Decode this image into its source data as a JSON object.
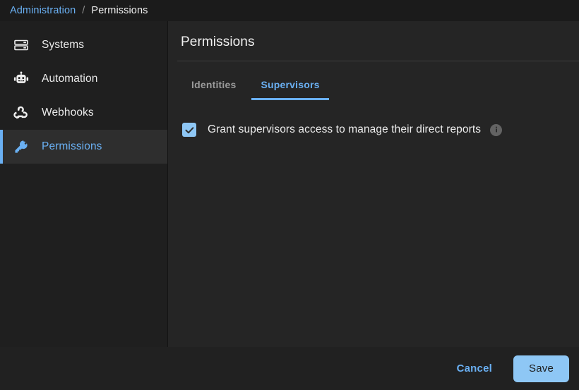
{
  "breadcrumb": {
    "root_label": "Administration",
    "separator": "/",
    "current_label": "Permissions"
  },
  "sidebar": {
    "items": [
      {
        "label": "Systems",
        "icon": "server-icon",
        "active": false
      },
      {
        "label": "Automation",
        "icon": "robot-icon",
        "active": false
      },
      {
        "label": "Webhooks",
        "icon": "webhook-icon",
        "active": false
      },
      {
        "label": "Permissions",
        "icon": "key-icon",
        "active": true
      }
    ]
  },
  "content": {
    "title": "Permissions",
    "tabs": [
      {
        "label": "Identities",
        "active": false
      },
      {
        "label": "Supervisors",
        "active": true
      }
    ],
    "settings": {
      "checkbox": {
        "label": "Grant supervisors access to manage their direct reports",
        "checked": true,
        "info_icon": "info-icon"
      }
    }
  },
  "footer": {
    "cancel_label": "Cancel",
    "save_label": "Save"
  },
  "colors": {
    "accent_blue": "#6ab0f3",
    "button_blue": "#8ec7f5",
    "background": "#252525",
    "sidebar_bg": "#1f1f1f",
    "topbar_bg": "#1b1b1b",
    "footer_bg": "#212121",
    "active_item_bg": "#2e2e2e",
    "muted_text": "#9a9a9a"
  }
}
